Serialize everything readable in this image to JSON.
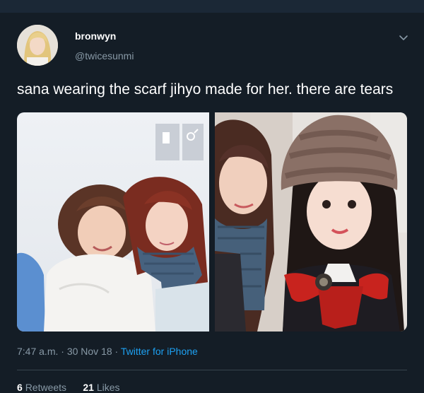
{
  "tweet": {
    "author_name": "bronwyn",
    "author_handle": "@twicesunmi",
    "text": "sana wearing the scarf jihyo made for her. there are tears",
    "time": "7:47 a.m.",
    "separator": "·",
    "date": "30 Nov 18",
    "source": "Twitter for iPhone",
    "retweets_count": "6",
    "retweets_label": "Retweets",
    "likes_count": "21",
    "likes_label": "Likes"
  },
  "icons": {
    "menu": "chevron-down-icon"
  },
  "colors": {
    "background": "#141d26",
    "topbar": "#1b2836",
    "secondary_text": "#8899a6",
    "link": "#1da1f2",
    "divider": "#38444d"
  }
}
